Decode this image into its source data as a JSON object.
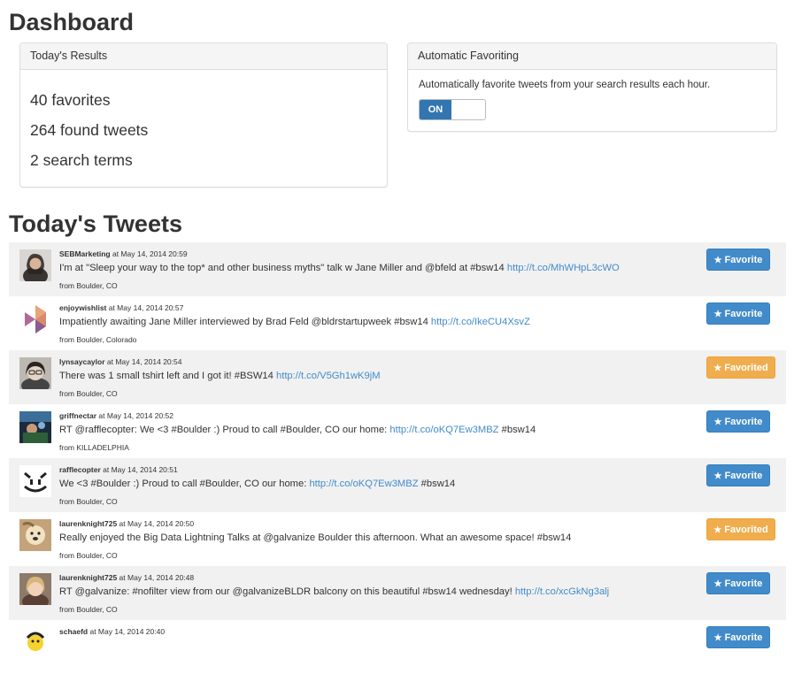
{
  "page": {
    "title": "Dashboard",
    "tweets_title": "Today's Tweets"
  },
  "results_panel": {
    "heading": "Today's Results",
    "favorites": "40 favorites",
    "found_tweets": "264 found tweets",
    "search_terms": "2 search terms"
  },
  "fav_panel": {
    "heading": "Automatic Favoriting",
    "description": "Automatically favorite tweets from your search results each hour.",
    "toggle_label": "ON"
  },
  "tweets": [
    {
      "user": "SEBMarketing",
      "time": " at May 14, 2014 20:59",
      "text": "I'm at \"Sleep your way to the top* and other business myths\" talk w Jane Miller and @bfeld at #bsw14 ",
      "link": "http://t.co/MhWHpL3cWO",
      "after": "",
      "location": "from Boulder, CO",
      "button": "Favorite",
      "state": "favorite"
    },
    {
      "user": "enjoywishlist",
      "time": " at May 14, 2014 20:57",
      "text": "Impatiently awaiting Jane Miller interviewed by Brad Feld @bldrstartupweek #bsw14 ",
      "link": "http://t.co/IkeCU4XsvZ",
      "after": "",
      "location": "from Boulder, Colorado",
      "button": "Favorite",
      "state": "favorite"
    },
    {
      "user": "lynsaycaylor",
      "time": " at May 14, 2014 20:54",
      "text": "There was 1 small tshirt left and I got it! #BSW14 ",
      "link": "http://t.co/V5Gh1wK9jM",
      "after": "",
      "location": "from Boulder, CO",
      "button": "Favorited",
      "state": "favorited"
    },
    {
      "user": "griffnectar",
      "time": " at May 14, 2014 20:52",
      "text": "RT @rafflecopter: We <3 #Boulder :) Proud to call #Boulder, CO our home: ",
      "link": "http://t.co/oKQ7Ew3MBZ",
      "after": " #bsw14",
      "location": "from KILLADELPHIA",
      "button": "Favorite",
      "state": "favorite"
    },
    {
      "user": "rafflecopter",
      "time": " at May 14, 2014 20:51",
      "text": "We <3 #Boulder :) Proud to call #Boulder, CO our home: ",
      "link": "http://t.co/oKQ7Ew3MBZ",
      "after": " #bsw14",
      "location": "from Boulder, CO",
      "button": "Favorite",
      "state": "favorite"
    },
    {
      "user": "laurenknight725",
      "time": " at May 14, 2014 20:50",
      "text": "Really enjoyed the Big Data Lightning Talks at @galvanize Boulder this afternoon. What an awesome space! #bsw14",
      "link": "",
      "after": "",
      "location": "from Boulder, CO",
      "button": "Favorited",
      "state": "favorited"
    },
    {
      "user": "laurenknight725",
      "time": " at May 14, 2014 20:48",
      "text": "RT @galvanize: #nofilter view from our @galvanizeBLDR balcony on this beautiful #bsw14 wednesday! ",
      "link": "http://t.co/xcGkNg3alj",
      "after": "",
      "location": "from Boulder, CO",
      "button": "Favorite",
      "state": "favorite"
    },
    {
      "user": "schaefd",
      "time": " at May 14, 2014 20:40",
      "text": "",
      "link": "",
      "after": "",
      "location": "",
      "button": "Favorite",
      "state": "favorite"
    }
  ],
  "icons": {
    "star": "star-icon"
  },
  "colors": {
    "primary": "#428bca",
    "warning": "#f0ad4e",
    "toggle_on": "#3276b1",
    "stripe": "#f1f1f1"
  }
}
